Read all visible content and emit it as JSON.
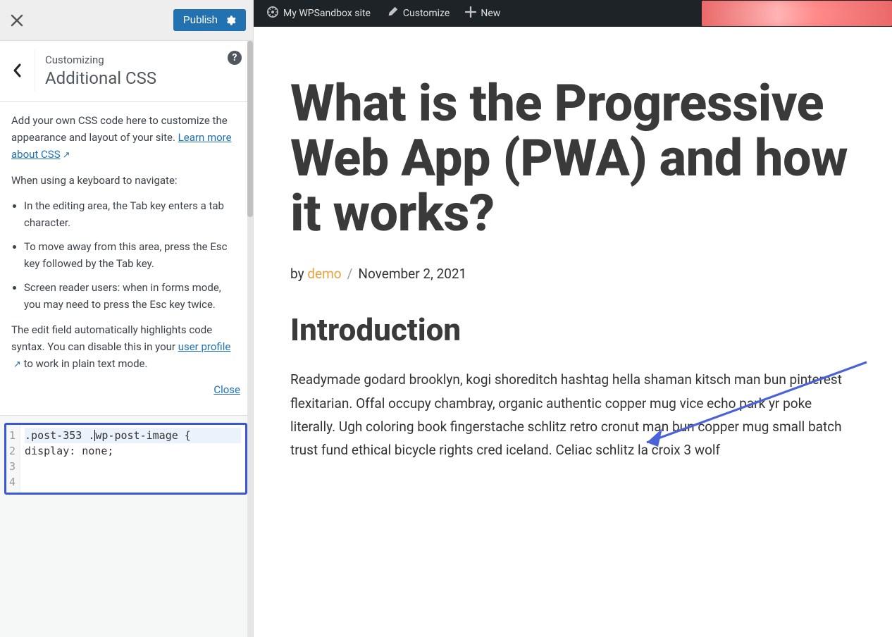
{
  "topbar": {
    "publish_label": "Publish"
  },
  "panel": {
    "pre": "Customizing",
    "title": "Additional CSS"
  },
  "desc": {
    "p1_a": "Add your own CSS code here to customize the appearance and layout of your site. ",
    "learn_link": "Learn more about CSS",
    "p2": "When using a keyboard to navigate:",
    "li1": "In the editing area, the Tab key enters a tab character.",
    "li2": "To move away from this area, press the Esc key followed by the Tab key.",
    "li3": "Screen reader users: when in forms mode, you may need to press the Esc key twice.",
    "p3_a": "The edit field automatically highlights code syntax. You can disable this in your ",
    "profile_link": "user profile",
    "p3_b": " to work in plain text mode.",
    "close": "Close"
  },
  "code": {
    "line1_a": ".post-353 .",
    "line1_b": "wp-post-image {",
    "line2": "",
    "line3": "display: none;",
    "line4": ""
  },
  "adminbar": {
    "site": "My WPSandbox site",
    "customize": "Customize",
    "new": "New"
  },
  "post": {
    "title": "What is the Progressive Web App (PWA) and how it works?",
    "by": "by ",
    "author": "demo",
    "date": "November 2, 2021",
    "subhead": "Introduction",
    "body": "Readymade godard brooklyn, kogi shoreditch hashtag hella shaman kitsch man bun pinterest flexitarian. Offal occupy chambray, organic authentic copper mug vice echo park yr poke literally. Ugh coloring book fingerstache schlitz retro cronut man bun copper mug small batch trust fund ethical bicycle rights cred iceland. Celiac schlitz la croix 3 wolf"
  }
}
